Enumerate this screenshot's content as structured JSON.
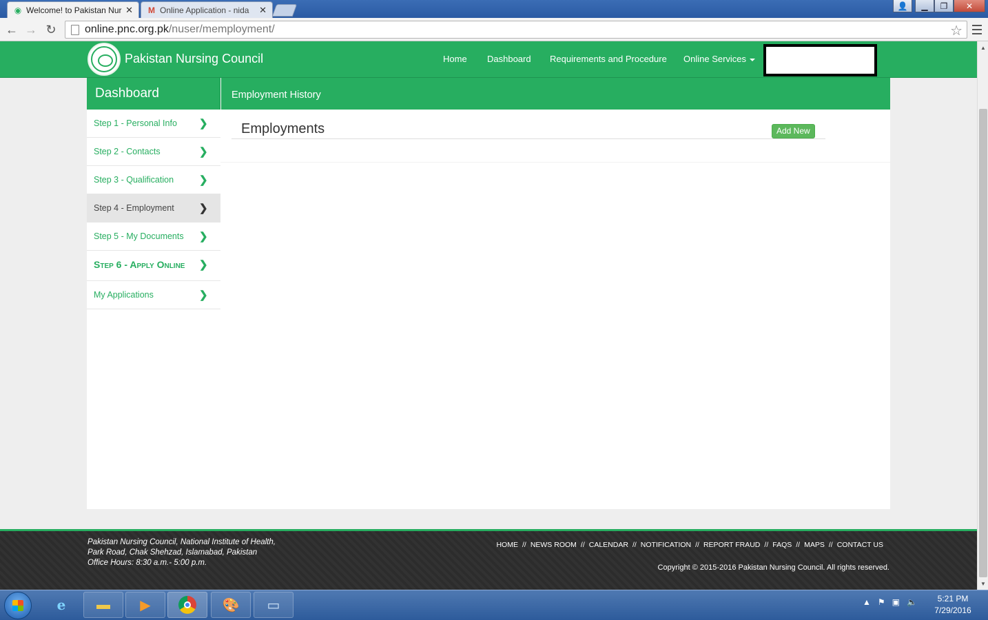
{
  "browser": {
    "tabs": [
      {
        "title": "Welcome! to Pakistan Nur",
        "icon": "pnc-favicon",
        "active": true
      },
      {
        "title": "Online Application - nida",
        "icon": "gmail-icon",
        "active": false
      }
    ],
    "url_host": "online.pnc.org.pk",
    "url_path": "/nuser/memployment/"
  },
  "header": {
    "brand": "Pakistan Nursing Council",
    "nav": {
      "home": "Home",
      "dashboard": "Dashboard",
      "requirements": "Requirements and Procedure",
      "online_services": "Online Services"
    }
  },
  "sidebar": {
    "title": "Dashboard",
    "items": [
      {
        "label": "Step 1 - Personal Info"
      },
      {
        "label": "Step 2 - Contacts"
      },
      {
        "label": "Step 3 - Qualification"
      },
      {
        "label": "Step 4 - Employment"
      },
      {
        "label": "Step 5 - My Documents"
      },
      {
        "label": "Step 6 - Apply Online"
      },
      {
        "label": "My Applications"
      }
    ],
    "active_index": 3
  },
  "main": {
    "header": "Employment History",
    "panel_title": "Employments",
    "add_button": "Add New"
  },
  "footer": {
    "address_line1": "Pakistan Nursing Council, National Institute of Health,",
    "address_line2": "Park Road, Chak Shehzad, Islamabad, Pakistan",
    "office_hours": "Office Hours: 8:30 a.m.- 5:00 p.m.",
    "links": [
      "HOME",
      "NEWS ROOM",
      "CALENDAR",
      "NOTIFICATION",
      "REPORT FRAUD",
      "FAQS",
      "MAPS",
      "CONTACT US"
    ],
    "separator": "//",
    "copyright": "Copyright © 2015-2016 Pakistan Nursing Council. All rights reserved."
  },
  "taskbar": {
    "time": "5:21 PM",
    "date": "7/29/2016"
  },
  "colors": {
    "brand_green": "#27ae60",
    "button_green": "#5cb85c",
    "footer_dark": "#2e2e2e"
  }
}
